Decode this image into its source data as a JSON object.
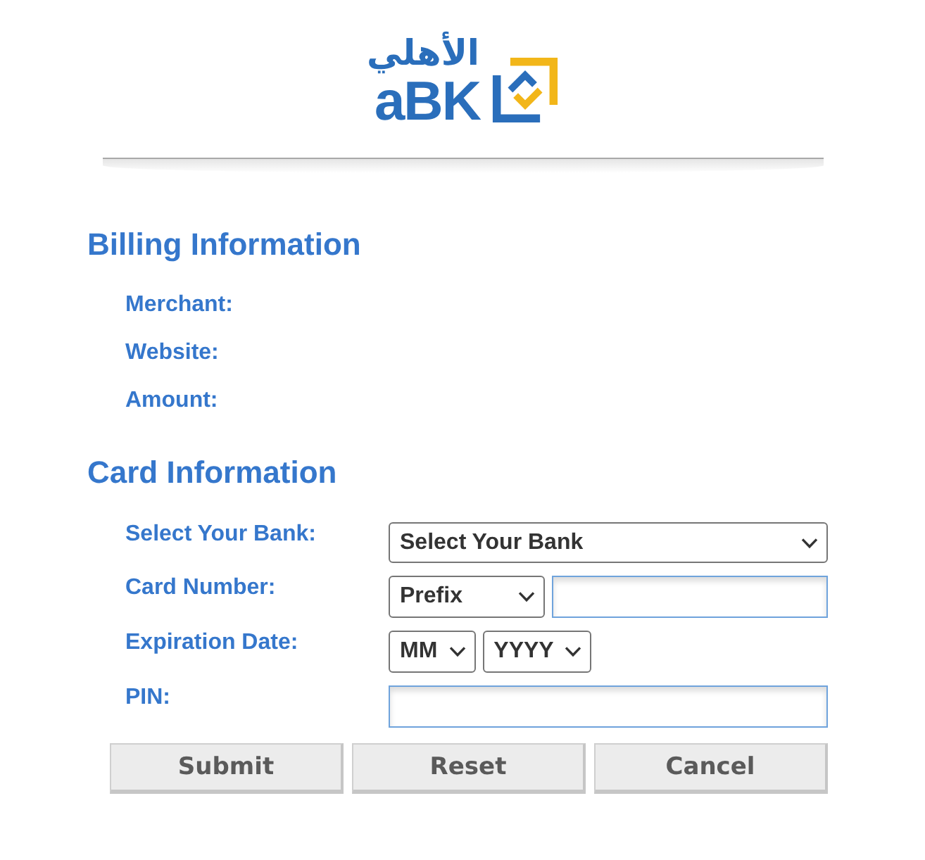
{
  "logo": {
    "arabic": "الأهلي",
    "latin": "aBK"
  },
  "billing": {
    "title": "Billing Information",
    "fields": [
      {
        "label": "Merchant:"
      },
      {
        "label": "Website:"
      },
      {
        "label": "Amount:"
      }
    ]
  },
  "card": {
    "title": "Card Information",
    "fields": [
      {
        "label": "Select Your Bank:",
        "controls": [
          {
            "kind": "select",
            "value": "Select Your Bank"
          }
        ]
      },
      {
        "label": "Card Number:",
        "controls": [
          {
            "kind": "select",
            "value": "Prefix"
          },
          {
            "kind": "input"
          }
        ]
      },
      {
        "label": "Expiration Date:",
        "controls": [
          {
            "kind": "select",
            "value": "MM"
          },
          {
            "kind": "select",
            "value": "YYYY"
          }
        ]
      },
      {
        "label": "PIN:",
        "controls": [
          {
            "kind": "input"
          }
        ]
      }
    ]
  },
  "buttons": [
    "Submit",
    "Reset",
    "Cancel"
  ]
}
